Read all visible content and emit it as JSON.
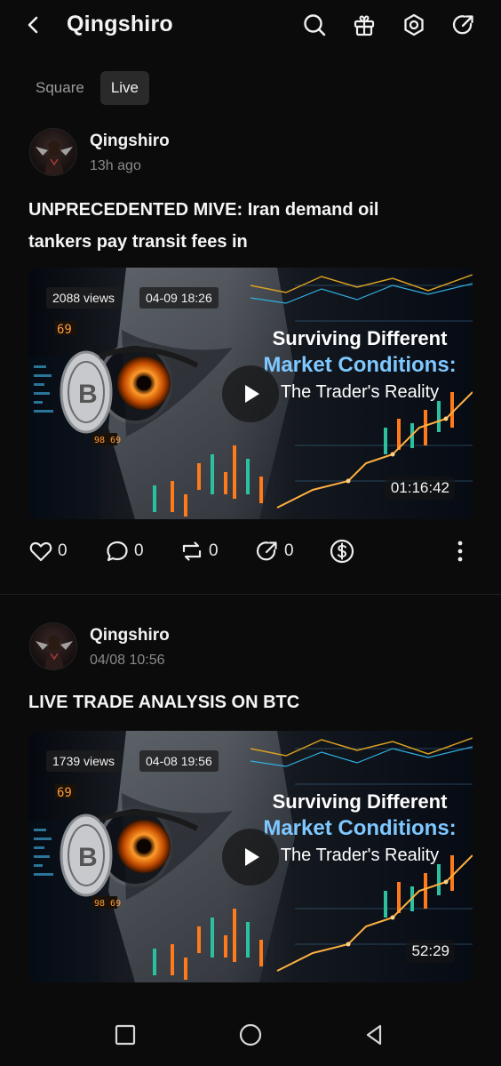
{
  "header": {
    "title": "Qingshiro",
    "icons": [
      "chevron-left-icon",
      "search-icon",
      "gift-icon",
      "settings-hexagon-icon",
      "share-icon"
    ]
  },
  "tabs": [
    {
      "label": "Square",
      "active": false
    },
    {
      "label": "Live",
      "active": true
    }
  ],
  "posts": [
    {
      "author": "Qingshiro",
      "time": "13h ago",
      "title_line1": "UNPRECEDENTED MIVE: Iran demand oil",
      "title_line2": "tankers pay transit fees in",
      "video": {
        "views": "2088 views",
        "date": "04-09 18:26",
        "duration": "01:16:42",
        "thumb_line1": "Surviving Different",
        "thumb_line2": "Market Conditions:",
        "thumb_line3": "The Trader's Reality",
        "ticker_a": "69",
        "ticker_b": "98 69"
      },
      "stats": {
        "likes": "0",
        "comments": "0",
        "reposts": "0",
        "shares": "0"
      }
    },
    {
      "author": "Qingshiro",
      "time": "04/08 10:56",
      "title_line1": "LIVE TRADE ANALYSIS ON BTC",
      "video": {
        "views": "1739 views",
        "date": "04-08 19:56",
        "duration": "52:29",
        "thumb_line1": "Surviving Different",
        "thumb_line2": "Market Conditions:",
        "thumb_line3": "The Trader's Reality",
        "ticker_a": "69",
        "ticker_b": "98 69"
      }
    }
  ],
  "colors": {
    "background": "#0b0b0b",
    "accent_blue": "#7ec8ff",
    "text": "#ececec",
    "muted": "#8a8a8a"
  }
}
